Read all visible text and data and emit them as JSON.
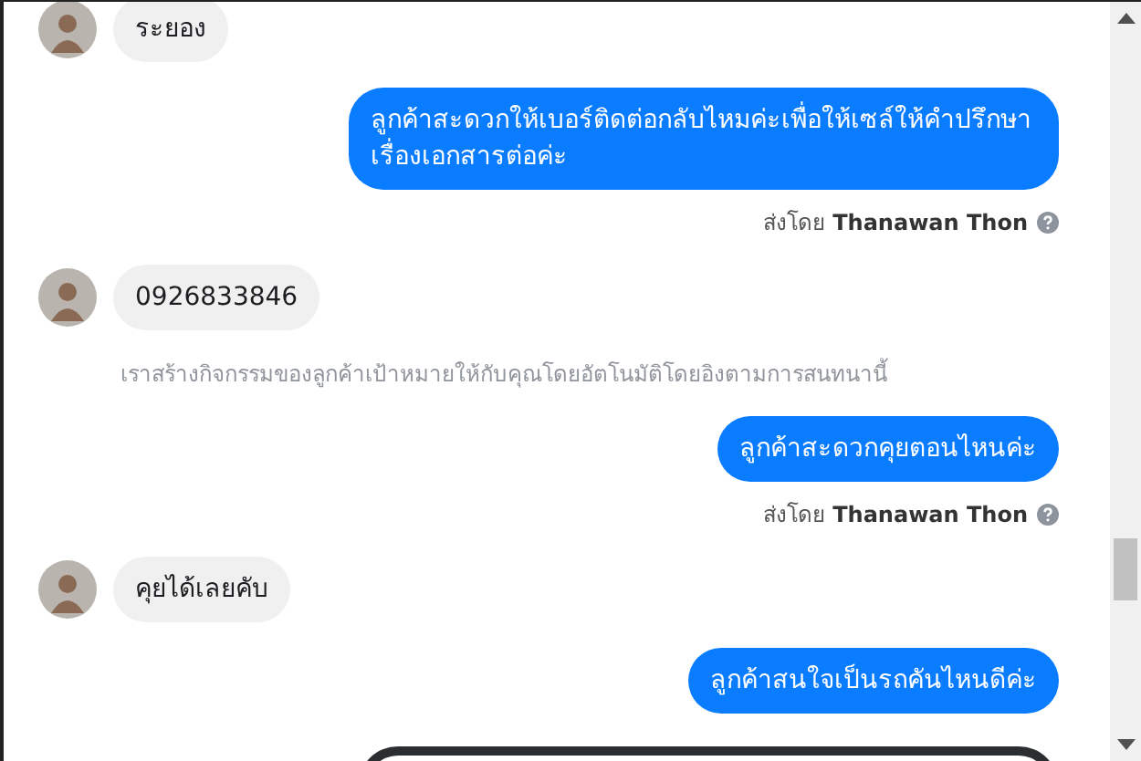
{
  "messages": [
    {
      "kind": "incoming",
      "text": "ระยอง"
    },
    {
      "kind": "outgoing",
      "text": "ลูกค้าสะดวกให้เบอร์ติดต่อกลับไหมค่ะเพื่อให้เซล์ให้คำปรึกษาเรื่องเอกสารต่อค่ะ",
      "sent_by_label": "ส่งโดย",
      "sender": "Thanawan Thon"
    },
    {
      "kind": "incoming",
      "text": "0926833846"
    },
    {
      "kind": "notice",
      "text": "เราสร้างกิจกรรมของลูกค้าเป้าหมายให้กับคุณโดยอัตโนมัติโดยอิงตามการสนทนานี้"
    },
    {
      "kind": "outgoing",
      "text": "ลูกค้าสะดวกคุยตอนไหนค่ะ",
      "sent_by_label": "ส่งโดย",
      "sender": "Thanawan Thon"
    },
    {
      "kind": "incoming",
      "text": "คุยได้เลยคับ"
    },
    {
      "kind": "outgoing",
      "text": "ลูกค้าสนใจเป็นรถคันไหนดีค่ะ"
    },
    {
      "kind": "attachment"
    }
  ]
}
